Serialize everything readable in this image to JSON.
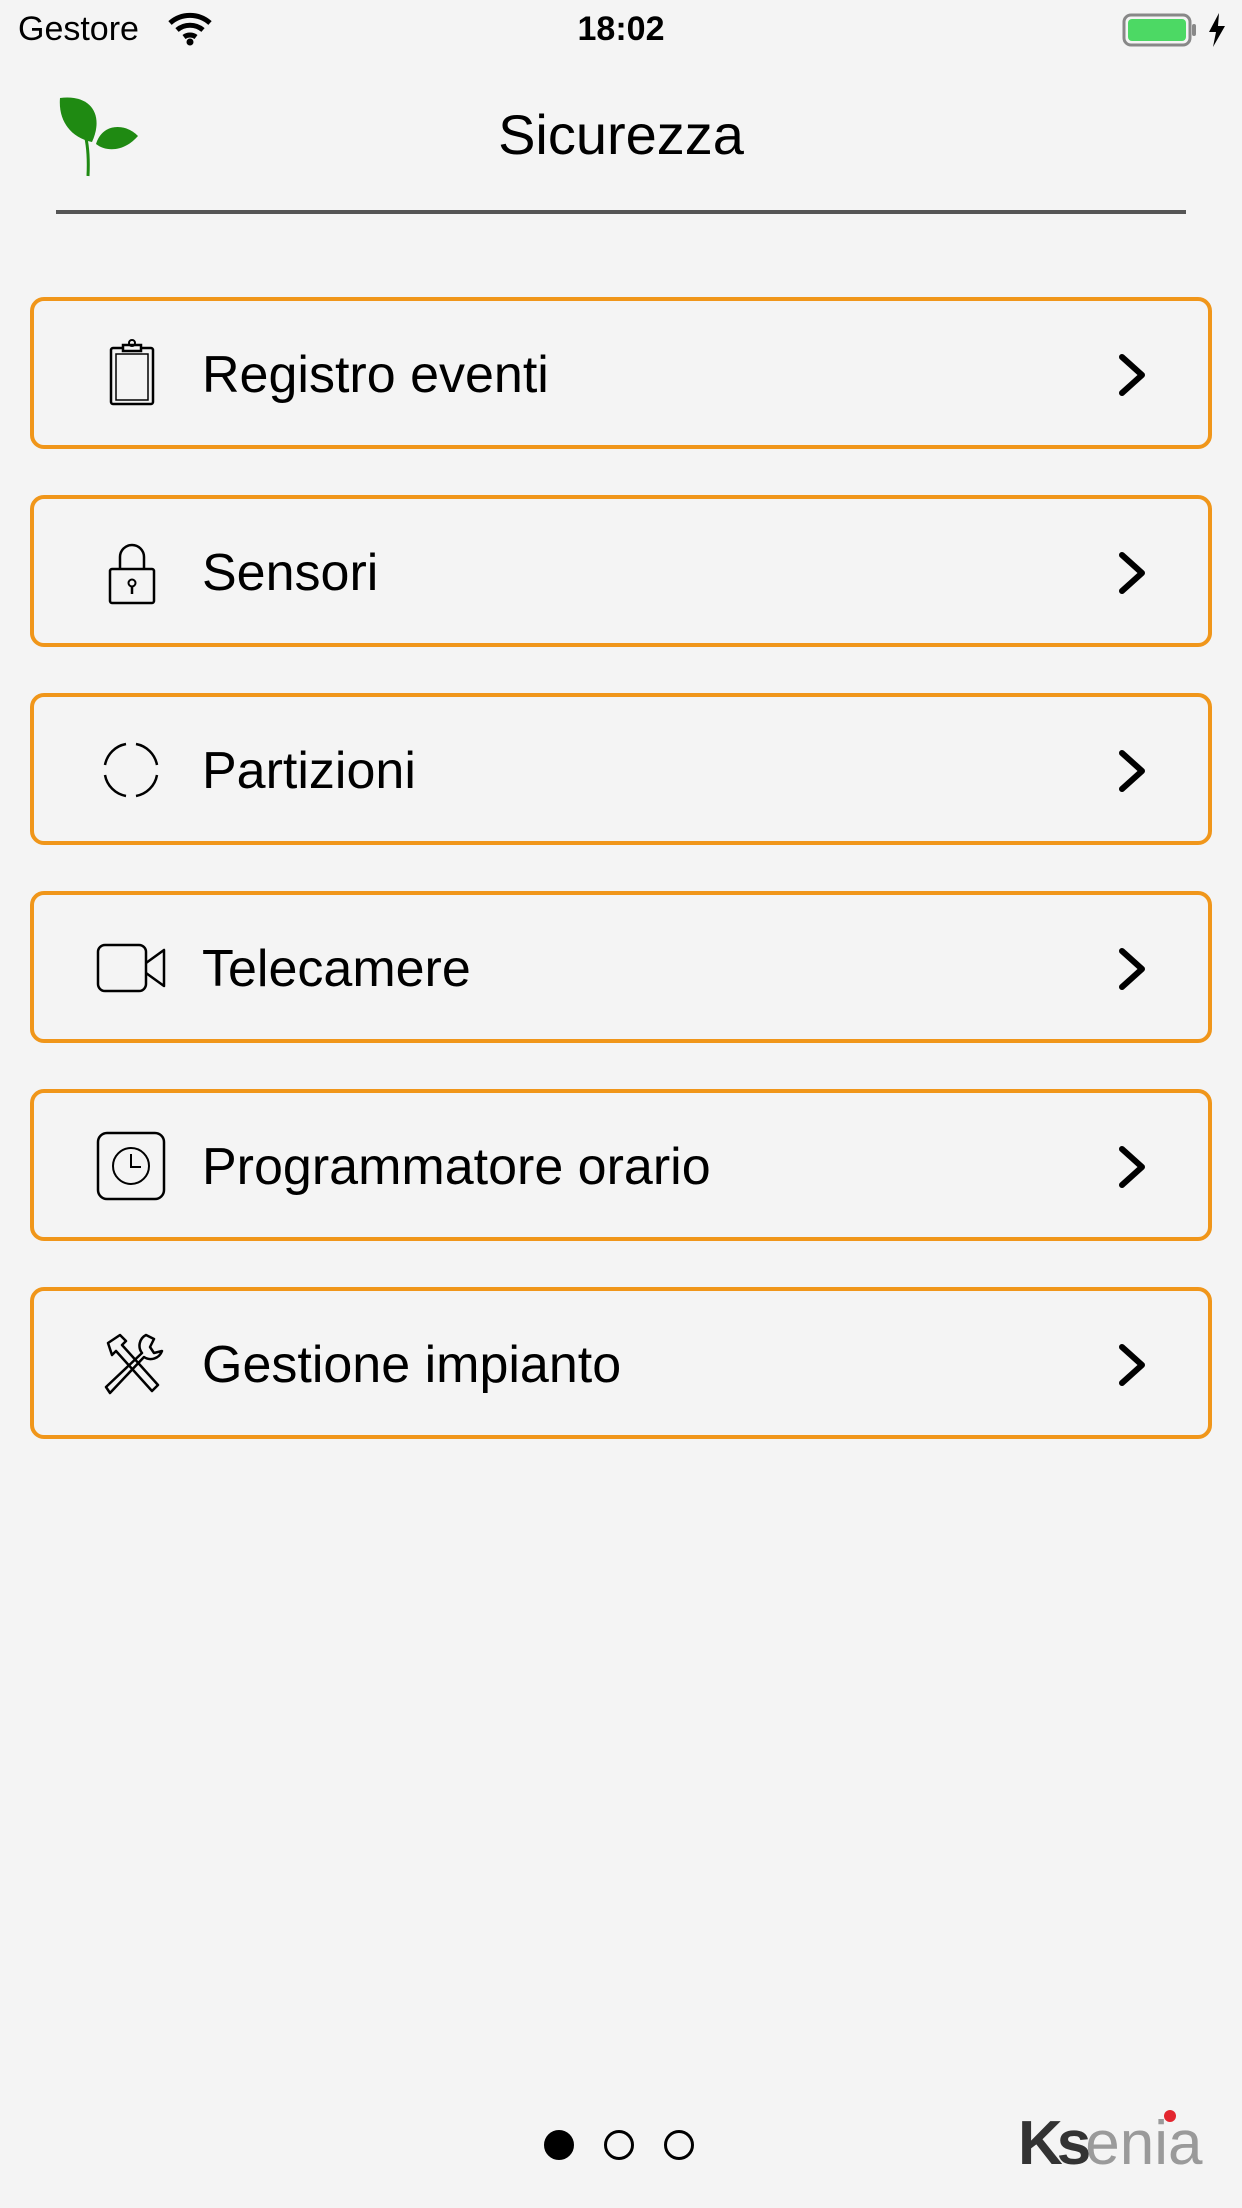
{
  "status_bar": {
    "carrier": "Gestore",
    "time": "18:02",
    "battery_color": "#4cd964"
  },
  "header": {
    "title": "Sicurezza",
    "logo_icon": "green-leaf-icon",
    "logo_color": "#1f8a12",
    "rule_color": "#555555"
  },
  "menu": {
    "border_color": "#f0961a",
    "items": [
      {
        "label": "Registro eventi",
        "icon": "clipboard-icon"
      },
      {
        "label": "Sensori",
        "icon": "padlock-icon"
      },
      {
        "label": "Partizioni",
        "icon": "partition-circle-icon"
      },
      {
        "label": "Telecamere",
        "icon": "video-camera-icon"
      },
      {
        "label": "Programmatore orario",
        "icon": "clock-icon"
      },
      {
        "label": "Gestione impianto",
        "icon": "tools-icon"
      }
    ]
  },
  "pager": {
    "pages": 3,
    "current": 1
  },
  "brand": {
    "name": "Ksenia",
    "logo_text_dark": "Ks",
    "logo_text_light": "enia",
    "dot_color": "#e3262f"
  }
}
